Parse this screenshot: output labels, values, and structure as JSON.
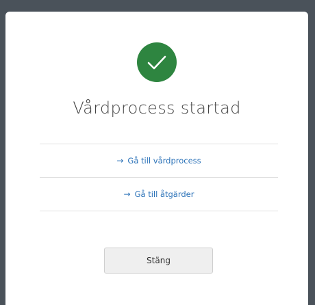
{
  "dialog": {
    "title": "Vårdprocess startad",
    "status_icon": "check-icon",
    "links": [
      {
        "arrow": "→",
        "label": "Gå till vårdprocess"
      },
      {
        "arrow": "→",
        "label": "Gå till åtgärder"
      }
    ],
    "close_label": "Stäng"
  },
  "colors": {
    "success": "#2e8540",
    "link": "#2b72b8",
    "backdrop": "#4a525a"
  }
}
